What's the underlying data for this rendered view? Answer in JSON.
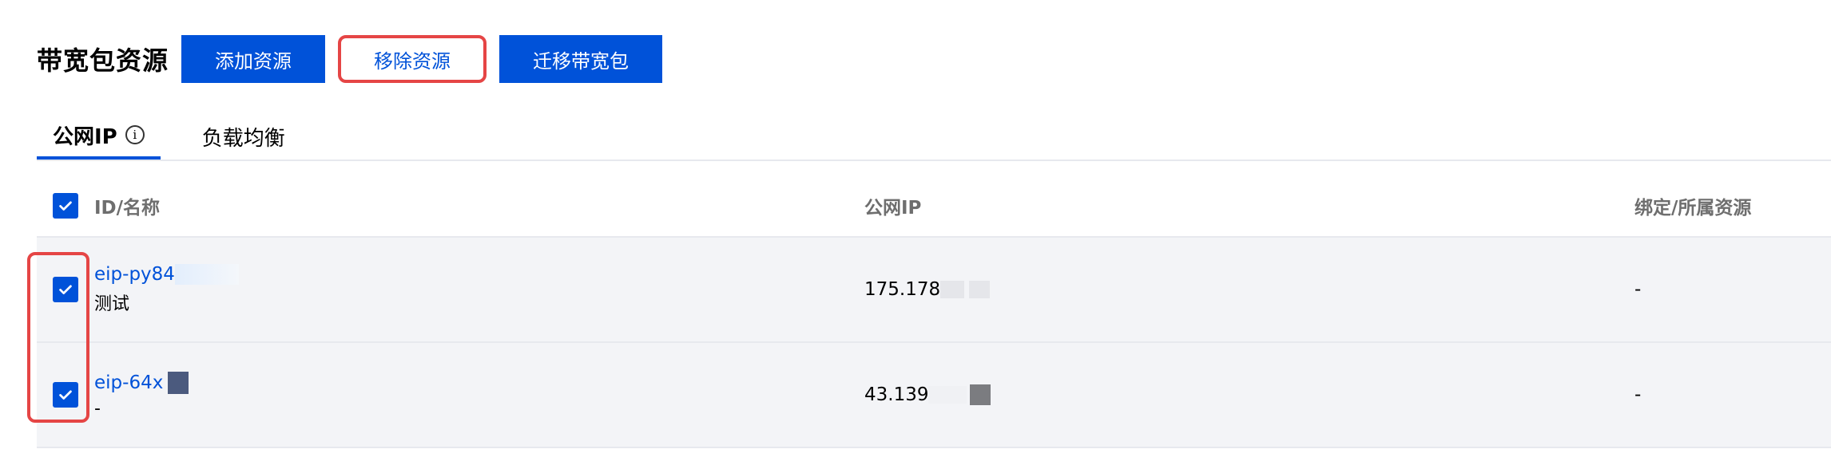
{
  "header": {
    "title": "带宽包资源",
    "add_label": "添加资源",
    "remove_label": "移除资源",
    "migrate_label": "迁移带宽包"
  },
  "tabs": [
    {
      "label": "公网IP",
      "active": true,
      "icon": "info-icon"
    },
    {
      "label": "负载均衡",
      "active": false
    }
  ],
  "table": {
    "columns": [
      "ID/名称",
      "公网IP",
      "绑定/所属资源"
    ],
    "rows": [
      {
        "id": "eip-py84",
        "name": "测试",
        "ip": "175.178",
        "bind": "-",
        "checked": true
      },
      {
        "id": "eip-64x",
        "name": "-",
        "ip": "43.139",
        "bind": "-",
        "checked": true
      }
    ]
  },
  "colors": {
    "primary": "#0052d9",
    "highlight": "#e54545",
    "row_bg": "#f3f4f7"
  }
}
